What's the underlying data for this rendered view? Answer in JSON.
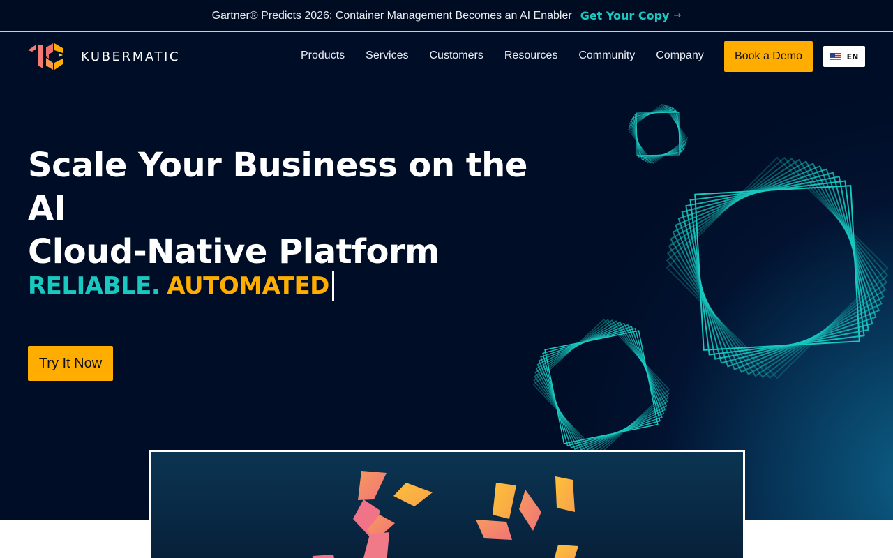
{
  "announcement": {
    "text": "Gartner® Predicts 2026: Container Management Becomes an AI Enabler",
    "link_label": "Get Your Copy",
    "link_arrow": "→"
  },
  "brand": {
    "name": "KUBERMATIC",
    "logo_icon": "kubermatic-logo-icon"
  },
  "nav": {
    "items": [
      {
        "label": "Products"
      },
      {
        "label": "Services"
      },
      {
        "label": "Customers"
      },
      {
        "label": "Resources"
      },
      {
        "label": "Community"
      },
      {
        "label": "Company"
      }
    ],
    "demo_label": "Book a Demo",
    "language": {
      "label": "EN",
      "flag_icon": "us-flag-icon"
    }
  },
  "hero": {
    "headline_line1": "Scale Your Business on the AI",
    "headline_line2": "Cloud-Native Platform",
    "tagline_part1": "RELIABLE.",
    "tagline_part2": "AUTOMATED",
    "cta_label": "Try It Now"
  },
  "colors": {
    "accent_yellow": "#ffad00",
    "accent_teal": "#19c9c0",
    "background_navy": "#000d26"
  }
}
